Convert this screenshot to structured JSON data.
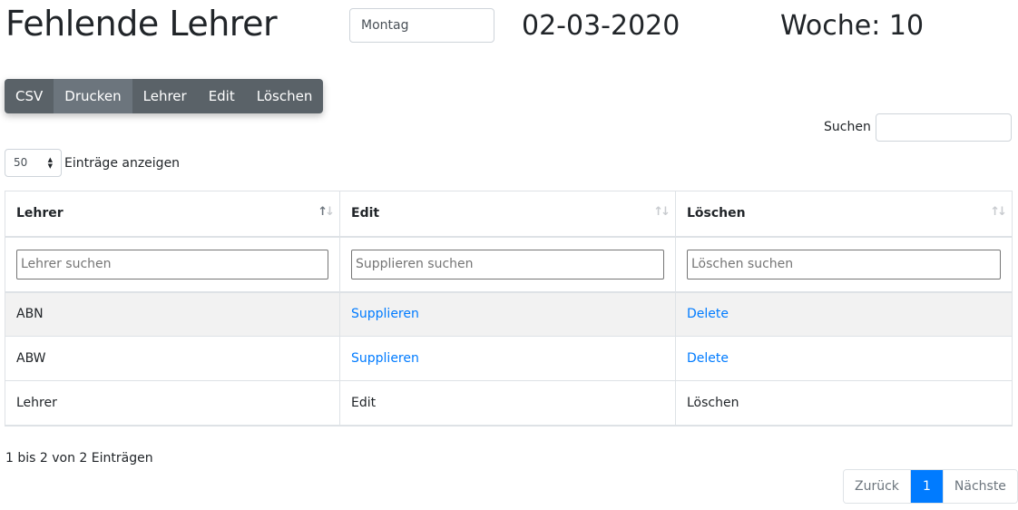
{
  "header": {
    "title": "Fehlende Lehrer",
    "day_select_value": "Montag",
    "date": "02-03-2020",
    "week": "Woche: 10"
  },
  "toolbar": {
    "buttons": [
      "CSV",
      "Drucken",
      "Lehrer",
      "Edit",
      "Löschen"
    ]
  },
  "search": {
    "label": "Suchen",
    "value": ""
  },
  "length": {
    "value": "50",
    "label": "Einträge anzeigen"
  },
  "table": {
    "columns": [
      "Lehrer",
      "Edit",
      "Löschen"
    ],
    "filters": [
      "Lehrer suchen",
      "Supplieren suchen",
      "Löschen suchen"
    ],
    "rows": [
      [
        "ABN",
        "Supplieren",
        "Delete"
      ],
      [
        "ABW",
        "Supplieren",
        "Delete"
      ]
    ],
    "footer": [
      "Lehrer",
      "Edit",
      "Löschen"
    ]
  },
  "info": "1 bis 2 von 2 Einträgen",
  "pagination": {
    "prev": "Zurück",
    "current": "1",
    "next": "Nächste"
  },
  "colors": {
    "link": "#007bff",
    "button": "#6c757d",
    "active_page": "#007bff"
  }
}
